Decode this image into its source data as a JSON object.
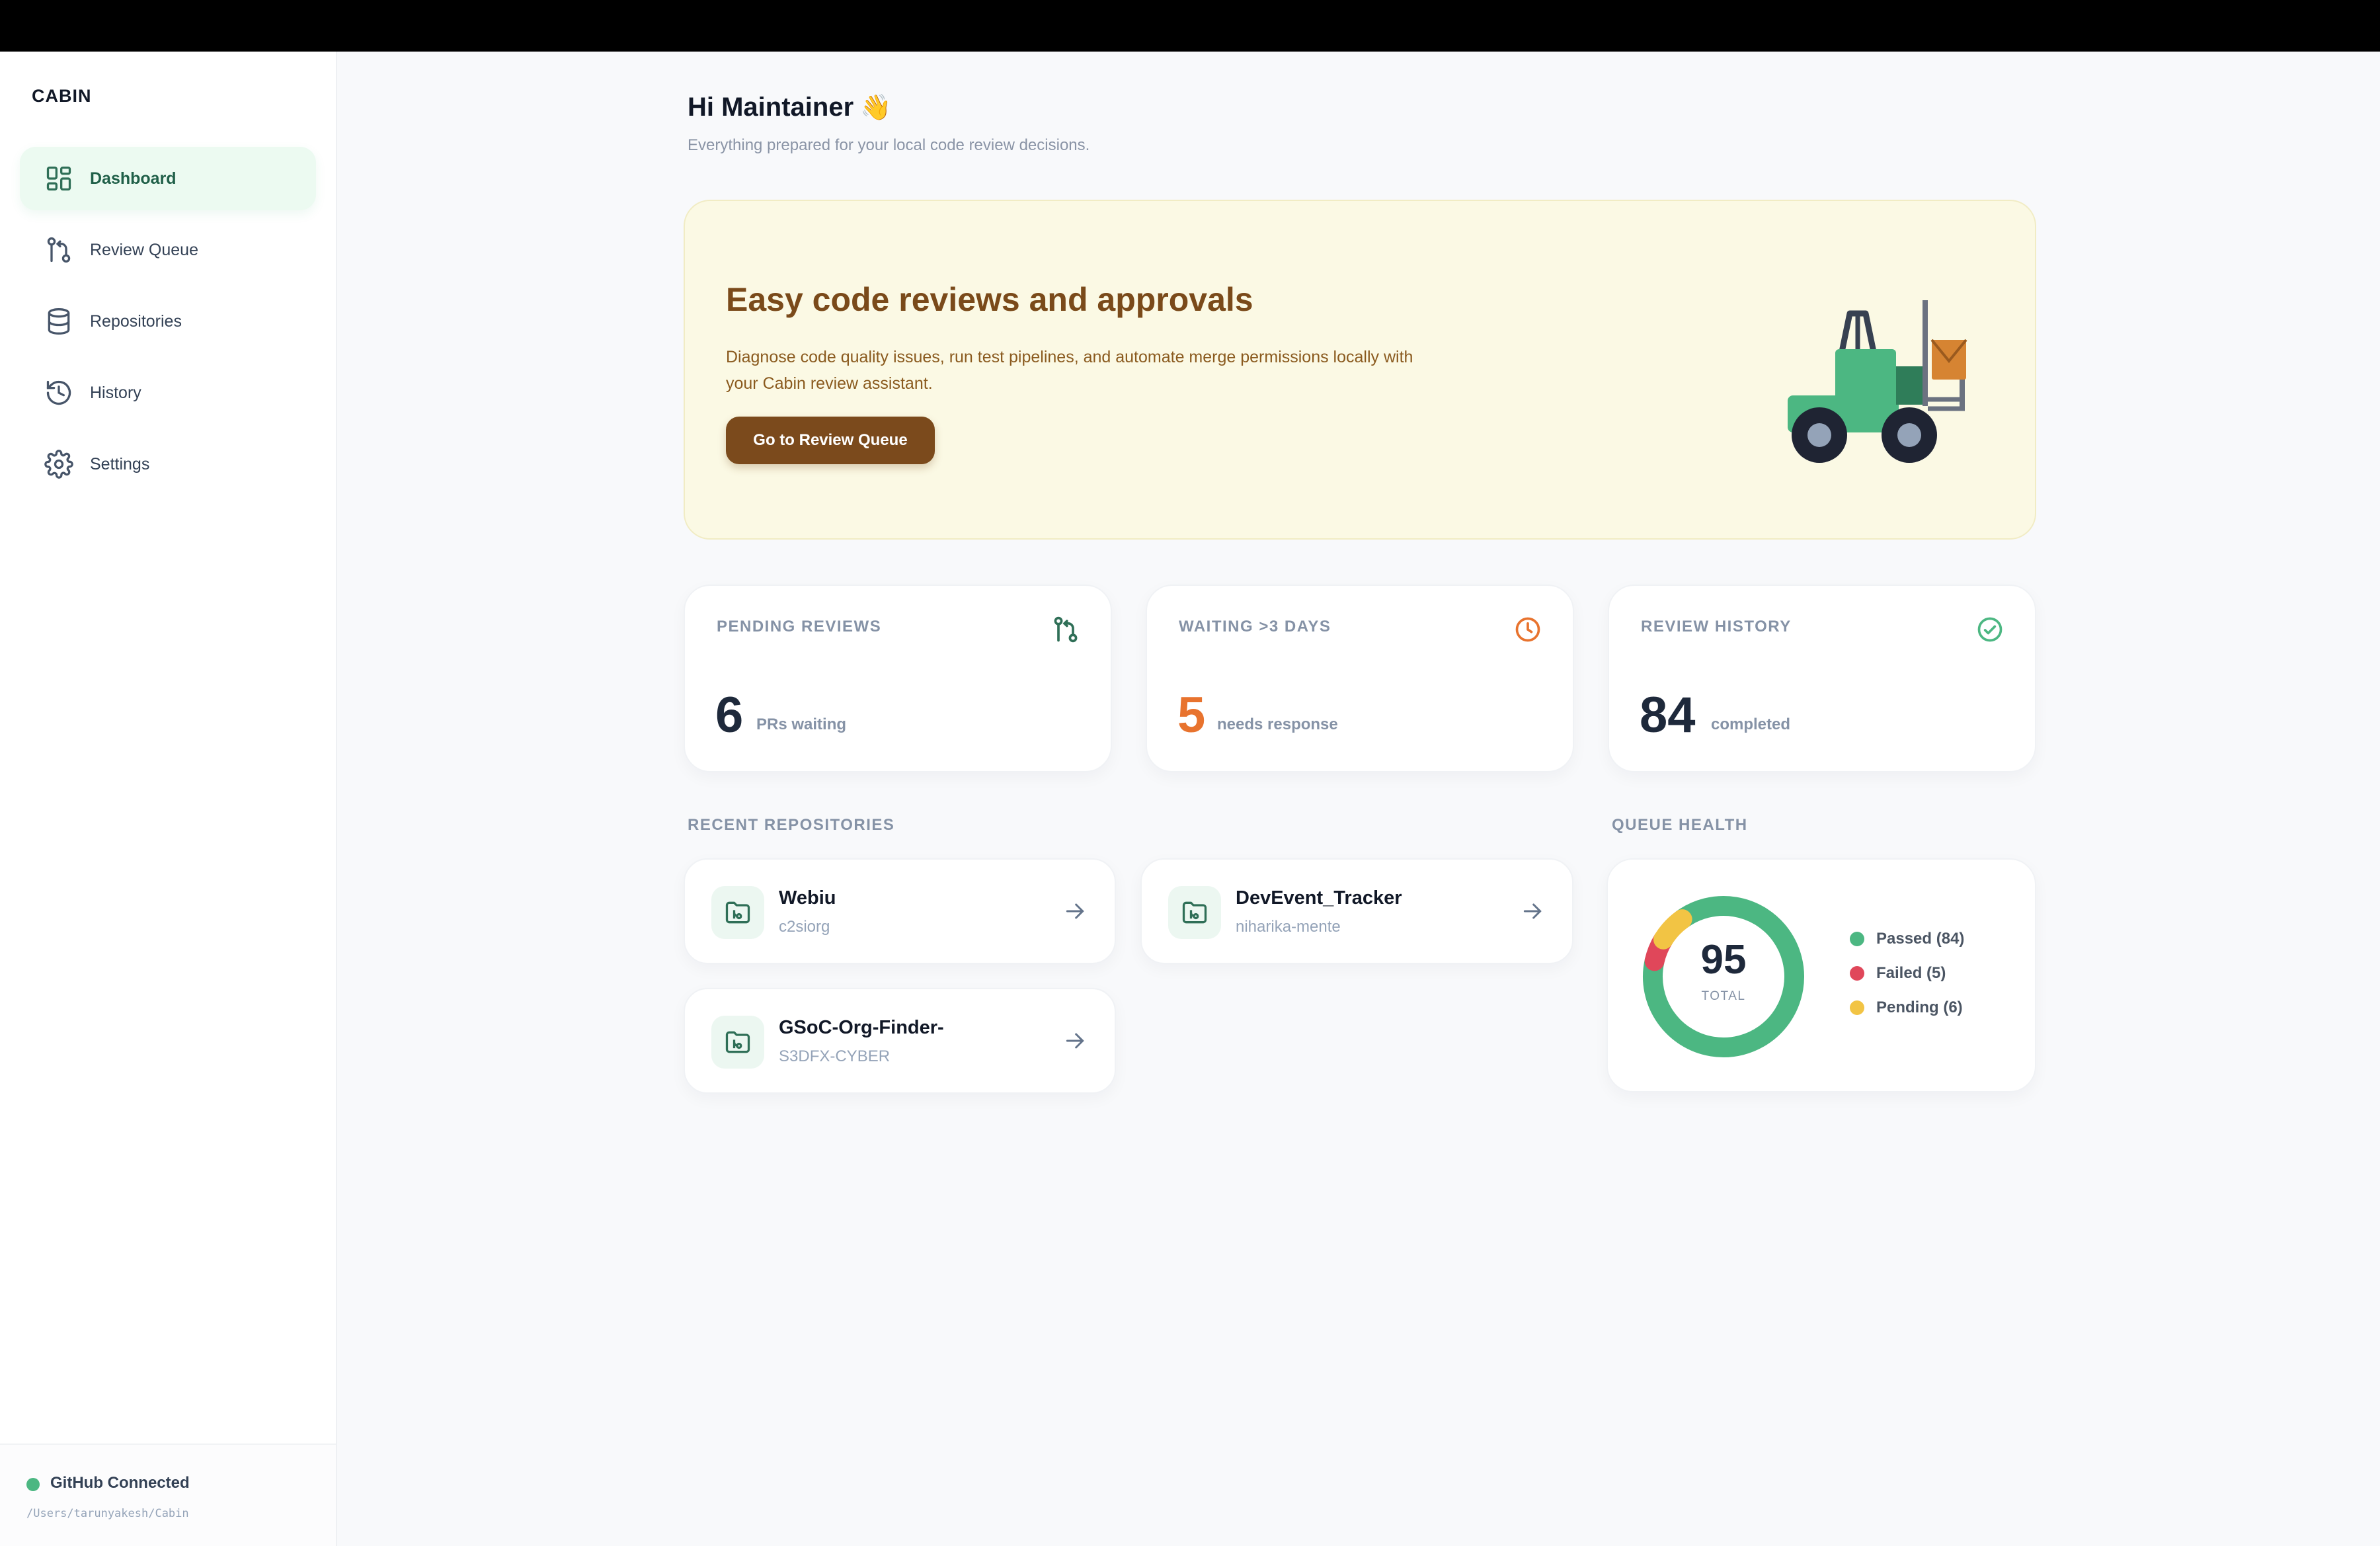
{
  "sidebar": {
    "brand": "CABIN",
    "items": [
      {
        "label": "Dashboard",
        "icon": "dashboard-icon",
        "active": true
      },
      {
        "label": "Review Queue",
        "icon": "git-pull-request-icon",
        "active": false
      },
      {
        "label": "Repositories",
        "icon": "database-icon",
        "active": false
      },
      {
        "label": "History",
        "icon": "history-icon",
        "active": false
      },
      {
        "label": "Settings",
        "icon": "gear-icon",
        "active": false
      }
    ],
    "footer": {
      "status": "GitHub Connected",
      "path": "/Users/tarunyakesh/Cabin"
    }
  },
  "header": {
    "greeting": "Hi Maintainer",
    "wave": "👋",
    "subtitle": "Everything prepared for your local code review decisions."
  },
  "hero": {
    "title": "Easy code reviews and approvals",
    "description": "Diagnose code quality issues, run test pipelines, and automate merge permissions locally with your Cabin review assistant.",
    "button": "Go to Review Queue"
  },
  "stats": [
    {
      "label": "PENDING REVIEWS",
      "value": "6",
      "unit": "PRs waiting",
      "icon": "git-pull-request-icon",
      "color": "#1e293b"
    },
    {
      "label": "WAITING >3 DAYS",
      "value": "5",
      "unit": "needs response",
      "icon": "clock-icon",
      "color": "#e8732e"
    },
    {
      "label": "REVIEW HISTORY",
      "value": "84",
      "unit": "completed",
      "icon": "check-circle-icon",
      "color": "#1e293b"
    }
  ],
  "recent": {
    "label": "RECENT REPOSITORIES",
    "repos": [
      {
        "name": "Webiu",
        "owner": "c2siorg"
      },
      {
        "name": "DevEvent_Tracker",
        "owner": "niharika-mente"
      },
      {
        "name": "GSoC-Org-Finder-",
        "owner": "S3DFX-CYBER"
      }
    ]
  },
  "queue_health": {
    "label": "QUEUE HEALTH",
    "total": "95",
    "caption": "TOTAL",
    "legend": [
      {
        "label": "Passed (84)",
        "value": 84,
        "color": "#4cb782"
      },
      {
        "label": "Failed (5)",
        "value": 5,
        "color": "#e0475a"
      },
      {
        "label": "Pending (6)",
        "value": 6,
        "color": "#f2c444"
      }
    ]
  },
  "colors": {
    "accent": "#4cb782",
    "brown": "#7b4a1c",
    "orange": "#e8732e"
  }
}
